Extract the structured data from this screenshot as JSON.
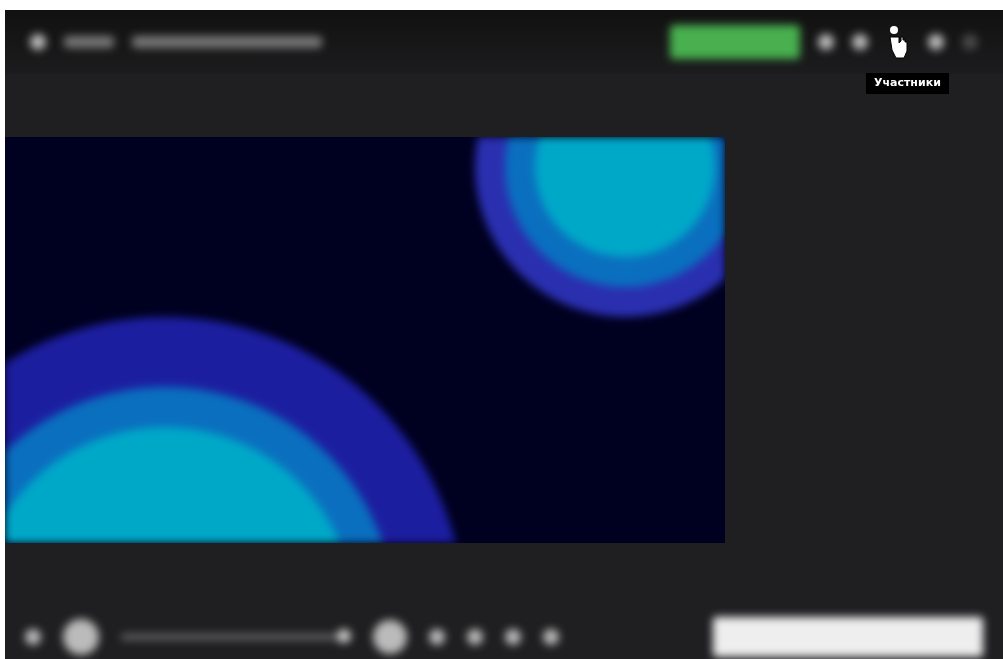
{
  "header": {
    "tooltip": "Участники"
  },
  "controls": {
    "progress_slider": {
      "level": 0.97
    }
  }
}
